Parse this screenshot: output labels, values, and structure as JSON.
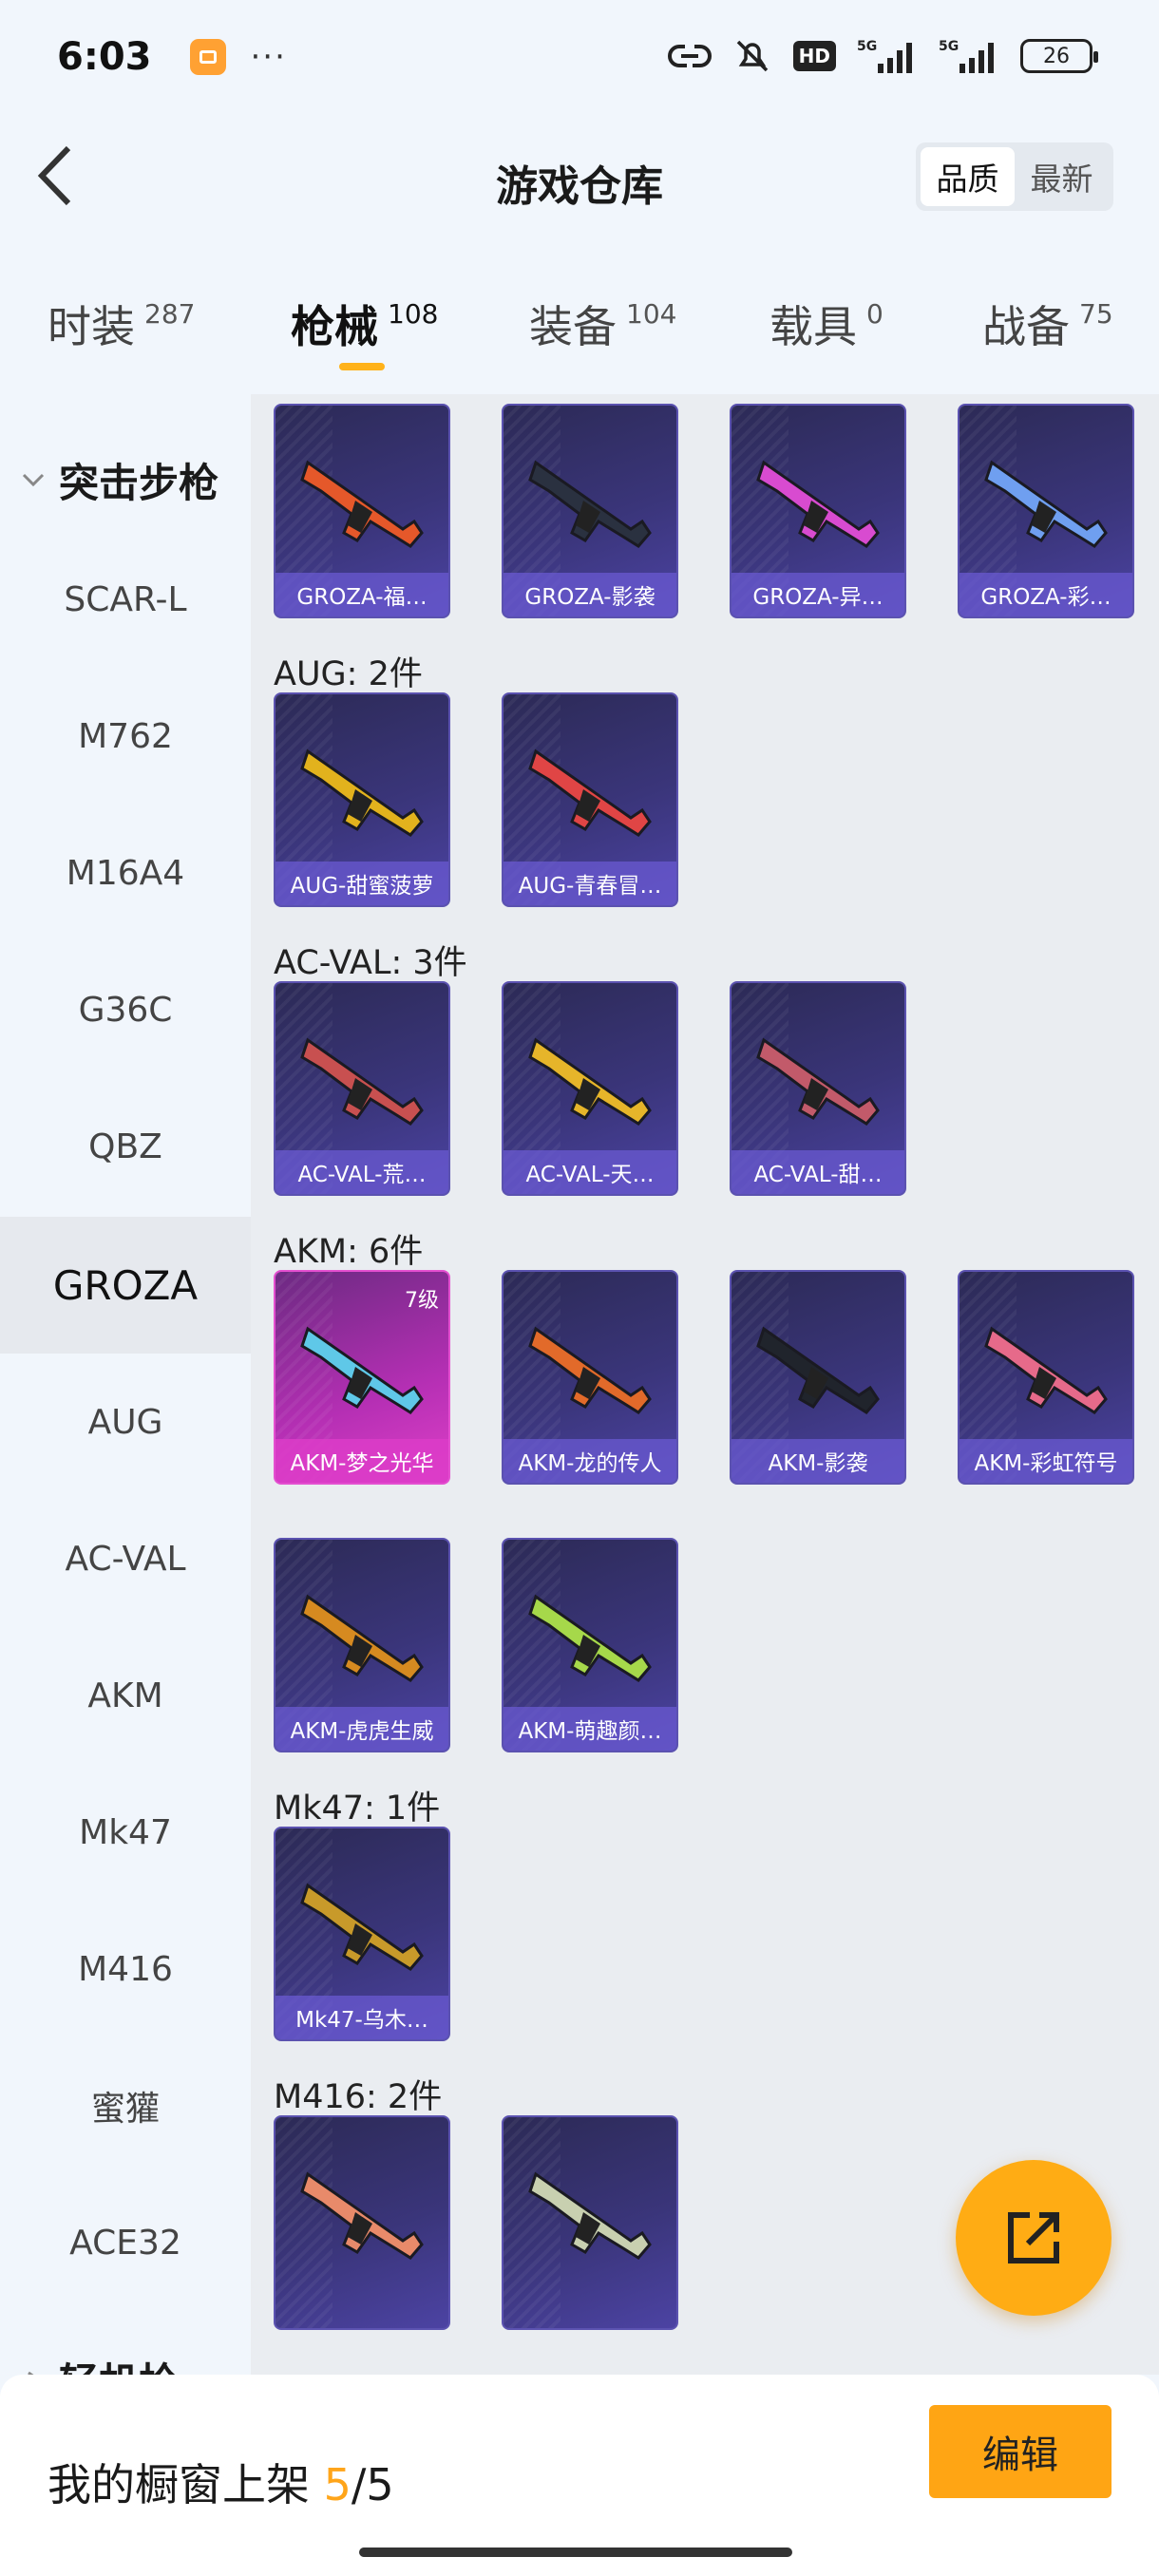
{
  "status_bar": {
    "time": "6:03",
    "dots": "···",
    "hd": "HD",
    "net1": "5G",
    "net2": "5G",
    "battery": "26"
  },
  "header": {
    "title": "游戏仓库",
    "sort_options": [
      "品质",
      "最新"
    ],
    "sort_selected": "品质"
  },
  "tabs": [
    {
      "label": "时装",
      "count": "287"
    },
    {
      "label": "枪械",
      "count": "108"
    },
    {
      "label": "装备",
      "count": "104"
    },
    {
      "label": "载具",
      "count": "0"
    },
    {
      "label": "战备",
      "count": "75"
    }
  ],
  "sidebar": {
    "group": "突击步枪",
    "items": [
      "SCAR-L",
      "M762",
      "M16A4",
      "G36C",
      "QBZ",
      "GROZA",
      "AUG",
      "AC-VAL",
      "AKM",
      "Mk47",
      "M416",
      "蜜獾",
      "ACE32"
    ],
    "next_group_partial": "轻机枪",
    "active": "GROZA"
  },
  "groups": [
    {
      "title": "",
      "items": [
        {
          "name": "GROZA-福…",
          "color": "#e5582a"
        },
        {
          "name": "GROZA-影袭",
          "color": "#2a3140"
        },
        {
          "name": "GROZA-异…",
          "color": "#d84bd0"
        },
        {
          "name": "GROZA-彩…",
          "color": "#6f9ff0"
        }
      ]
    },
    {
      "title": "AUG: 2件",
      "items": [
        {
          "name": "AUG-甜蜜菠萝",
          "color": "#e2b21d"
        },
        {
          "name": "AUG-青春冒…",
          "color": "#e04545"
        }
      ]
    },
    {
      "title": "AC-VAL: 3件",
      "items": [
        {
          "name": "AC-VAL-荒…",
          "color": "#c85050"
        },
        {
          "name": "AC-VAL-天…",
          "color": "#e6b52a"
        },
        {
          "name": "AC-VAL-甜…",
          "color": "#c25a6a"
        }
      ]
    },
    {
      "title": "AKM: 6件",
      "items": [
        {
          "name": "AKM-梦之光华",
          "color": "#5fc8e8",
          "level": "7级",
          "highlight": true
        },
        {
          "name": "AKM-龙的传人",
          "color": "#e26a2a"
        },
        {
          "name": "AKM-影袭",
          "color": "#20242c"
        },
        {
          "name": "AKM-彩虹符号",
          "color": "#e66a8a"
        },
        {
          "name": "AKM-虎虎生威",
          "color": "#d68a20"
        },
        {
          "name": "AKM-萌趣颜…",
          "color": "#a6d84a"
        }
      ]
    },
    {
      "title": "Mk47: 1件",
      "items": [
        {
          "name": "Mk47-乌木…",
          "color": "#c89a2a"
        }
      ]
    },
    {
      "title": "M416: 2件",
      "items": [
        {
          "name": "",
          "color": "#e88a6a"
        },
        {
          "name": "",
          "color": "#c8d0b0"
        }
      ]
    }
  ],
  "bottom_bar": {
    "label": "我的橱窗上架",
    "current": "5",
    "separator": "/",
    "total": "5",
    "edit_label": "编辑"
  }
}
